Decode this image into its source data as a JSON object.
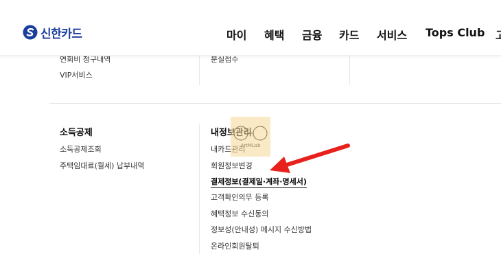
{
  "header": {
    "top_fragment": "·",
    "logo": {
      "text": "신한카드",
      "icon": "shinhan-s-logo-icon",
      "color": "#1a3e9e"
    },
    "nav": [
      "마이",
      "혜택",
      "금융",
      "카드",
      "서비스",
      "Tops Club",
      "고"
    ]
  },
  "menu": {
    "upper": {
      "left_links": [
        "연회비 청구내역",
        "VIP서비스"
      ],
      "mid_links": [
        "분실접수"
      ]
    },
    "left_section": {
      "title": "소득공제",
      "links": [
        "소득공제조회",
        "주택임대료(월세) 납부내역"
      ]
    },
    "right_section": {
      "title": "내정보관리",
      "links": [
        "내카드관리",
        "회원정보변경",
        "결제정보(결제일·계좌·명세서)",
        "고객확인의무 등록",
        "혜택정보 수신동의",
        "정보성(안내성) 메시지 수신방법",
        "온라인회원탈퇴"
      ],
      "active_index": 2
    }
  },
  "overlay": {
    "watermark_text": "ArtMLab",
    "arrow_color": "#e8211c"
  }
}
